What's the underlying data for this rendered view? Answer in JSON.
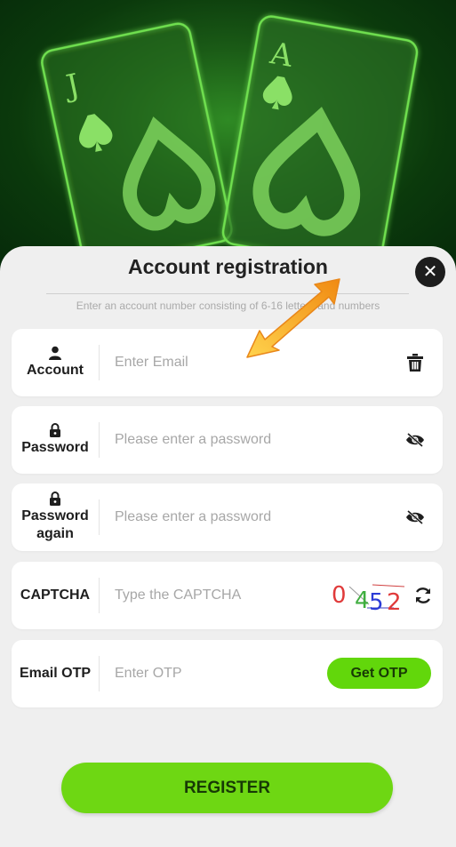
{
  "hero": {
    "card_left_rank": "J",
    "card_right_rank": "A"
  },
  "modal": {
    "title": "Account registration",
    "hint": "Enter an account number consisting of 6-16 letters and numbers",
    "close_label": "✕"
  },
  "fields": {
    "account": {
      "label": "Account",
      "placeholder": "Enter Email"
    },
    "password": {
      "label": "Password",
      "placeholder": "Please enter a password"
    },
    "password_again": {
      "label_line1": "Password",
      "label_line2": "again",
      "placeholder": "Please enter a password"
    },
    "captcha": {
      "label": "CAPTCHA",
      "placeholder": "Type the CAPTCHA",
      "digits": [
        "0",
        "4",
        "5",
        "2"
      ]
    },
    "email_otp": {
      "label": "Email OTP",
      "placeholder": "Enter OTP",
      "button_label": "Get OTP"
    }
  },
  "register_button": "REGISTER",
  "colors": {
    "accent_green": "#6ed713",
    "hero_green": "#1a5a16",
    "pointer_orange": "#f5a01c"
  },
  "icons": [
    "user-icon",
    "lock-icon",
    "trash-icon",
    "eye-slash-icon",
    "refresh-icon",
    "close-icon",
    "arrow-pointer-icon"
  ]
}
